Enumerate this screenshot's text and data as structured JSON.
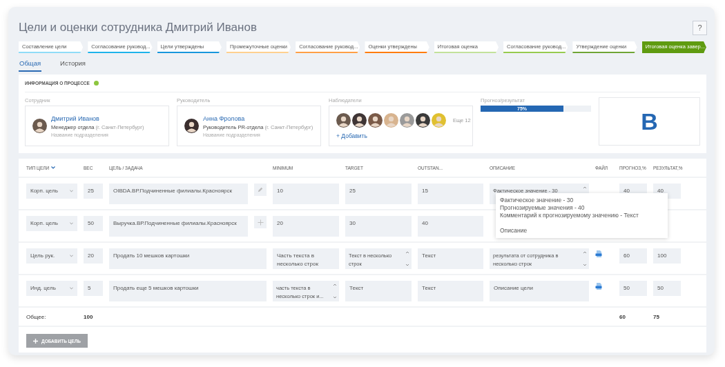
{
  "title": "Цели и оценки сотрудника Дмитрий Иванов",
  "help_button": "?",
  "steps": [
    {
      "label": "Составление цели",
      "color": "#8fdcf7",
      "selected": false
    },
    {
      "label": "Согласование руковод...",
      "color": "#1db3ea",
      "selected": false
    },
    {
      "label": "Цели утверждены",
      "color": "#1796dc",
      "selected": false
    },
    {
      "label": "Промежуточные оценки",
      "color": "#ffd08f",
      "selected": false
    },
    {
      "label": "Согласование руковод...",
      "color": "#ff9f45",
      "selected": false
    },
    {
      "label": "Оценки утверждены",
      "color": "#ff7c0a",
      "selected": false
    },
    {
      "label": "Итоговая оценка",
      "color": "#c2e19a",
      "selected": false
    },
    {
      "label": "Согласование руковод...",
      "color": "#96cb4e",
      "selected": false
    },
    {
      "label": "Утверждение оценки",
      "color": "#6fa535",
      "selected": false
    },
    {
      "label": "Итоговая оценка завер...",
      "color": "#5f9b10",
      "selected": true
    }
  ],
  "tabs": [
    {
      "label": "Общая",
      "selected": true
    },
    {
      "label": "История",
      "selected": false
    }
  ],
  "process_info": {
    "title": "ИНФОРМАЦИЯ О ПРОЦЕССЕ",
    "employee": {
      "label": "Сотрудник",
      "name": "Дмитрий Иванов",
      "position": "Менеджер отдела",
      "city": "(г. Санкт-Петербург)",
      "department": "Название подразделения"
    },
    "manager": {
      "label": "Руководитель",
      "name": "Анна Фролова",
      "position": "Руководитель PR-отдела",
      "city": "(г. Санкт-Петербург)",
      "department": "Название подразделения"
    },
    "observers": {
      "label": "Наблюдатели",
      "more": "Еще 12",
      "add_link": "+ Добавить"
    },
    "progress": {
      "label": "Прогноз/результат",
      "level": 0.75,
      "reading": "75%"
    },
    "grade": "B"
  },
  "table": {
    "columns": [
      {
        "label": "ТИП ЦЕЛИ",
        "sortable": true
      },
      {
        "label": "ВЕС",
        "sortable": false
      },
      {
        "label": "ЦЕЛЬ / ЗАДАЧА",
        "sortable": false
      },
      {
        "label": "MINIMUM",
        "sortable": false
      },
      {
        "label": "TARGET",
        "sortable": false
      },
      {
        "label": "OUTSTAN...",
        "sortable": false
      },
      {
        "label": "ОПИСАНИЕ",
        "sortable": false
      },
      {
        "label": "ФАЙЛ",
        "sortable": false
      },
      {
        "label": "ПРОГНОЗ,%",
        "sortable": false
      },
      {
        "label": "РЕЗУЛЬТАТ,%",
        "sortable": false
      }
    ],
    "rows": [
      {
        "type": "Корп. цель",
        "weight": "25",
        "goal": "OIBDA.ВР.Подчиненные филиалы.Красноярск",
        "kind": "edit",
        "minimum": {
          "value": "10",
          "scrollable": false
        },
        "target": {
          "value": "25",
          "scrollable": false
        },
        "outstanding": {
          "value": "15",
          "scrollable": false
        },
        "description": {
          "value": "Фактическое значение - 30",
          "scrollable": true
        },
        "file": false,
        "forecast": "40",
        "result": "40"
      },
      {
        "type": "Корп. цель",
        "weight": "50",
        "goal": "Выручка.ВР.Подчиненные филиалы.Красноярск",
        "kind": "add",
        "minimum": {
          "value": "20",
          "scrollable": false
        },
        "target": {
          "value": "30",
          "scrollable": false
        },
        "outstanding": {
          "value": "40",
          "scrollable": false
        },
        "file": false
      },
      {
        "type": "Цель рук.",
        "weight": "20",
        "goal": "Продать 10 мешков картошки",
        "minimum": {
          "value": "Часть текста в несколько строк",
          "scrollable": false
        },
        "target": {
          "value": "Текст в несколько строк",
          "scrollable": true
        },
        "outstanding": {
          "value": "Текст",
          "scrollable": false
        },
        "description": {
          "value": "результата от сотрудника в несколько строк",
          "scrollable": true
        },
        "file": true,
        "forecast": "60",
        "result": "100"
      },
      {
        "type": "Инд. цель",
        "weight": "5",
        "goal": "Продать еще 5 мешков картошки",
        "minimum": {
          "value": "часть текста в несколько строк и...",
          "scrollable": true
        },
        "target": {
          "value": "Текст",
          "scrollable": false
        },
        "outstanding": {
          "value": "Текст",
          "scrollable": false
        },
        "description": {
          "value": "Описание цели",
          "scrollable": false
        },
        "file": true,
        "forecast": "50",
        "result": "50"
      }
    ],
    "totals": {
      "label": "Общее:",
      "weight": "100",
      "forecast": "60",
      "result": "75"
    }
  },
  "tooltip": {
    "lines": [
      "Фактическое значение - 30",
      "Прогнозируемые значения - 40",
      "Комментарий к прогнозируемому значению - Текст"
    ],
    "note": "Описание"
  },
  "add_button": {
    "label": "ДОБАВИТЬ ЦЕЛЬ",
    "disabled": true
  }
}
